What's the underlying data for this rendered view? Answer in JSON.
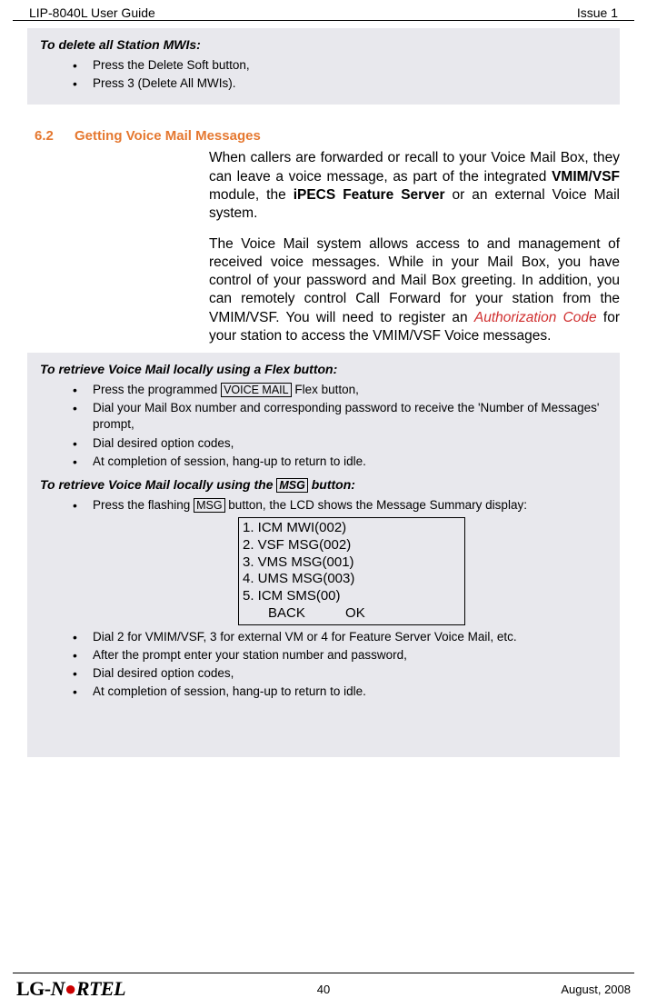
{
  "header": {
    "left": "LIP-8040L User Guide",
    "right": "Issue 1"
  },
  "box1": {
    "title": "To delete all Station MWIs:",
    "items": [
      "Press the Delete Soft button,",
      "Press 3 (Delete All MWIs)."
    ]
  },
  "section": {
    "num": "6.2",
    "title": "Getting Voice Mail Messages"
  },
  "para1_a": "When callers are forwarded or recall to your Voice Mail Box, they can leave a voice message, as part of the integrated ",
  "para1_b": "VMIM/VSF",
  "para1_c": " module, the ",
  "para1_d": "iPECS Feature Server",
  "para1_e": " or an external Voice Mail system.",
  "para2_a": "The Voice Mail system allows access to and management of received voice messages.  While in your Mail Box, you have control of your password and Mail Box greeting.  In addition, you can remotely control Call Forward for your station from the VMIM/VSF.  You will need to register an ",
  "para2_b": "Authorization Code",
  "para2_c": " for your station to access the VMIM/VSF Voice messages.",
  "box2": {
    "title1": "To retrieve Voice Mail locally using a Flex button:",
    "items1_pre": "Press the programmed ",
    "items1_key": "VOICE MAIL",
    "items1_post": " Flex button,",
    "items1b": "Dial your Mail Box number and corresponding password to receive the 'Number of Messages' prompt,",
    "items1c": "Dial desired option codes,",
    "items1d": "At completion of session, hang-up to return to idle.",
    "title2_pre": "To retrieve Voice Mail locally using the ",
    "title2_key": "MSG",
    "title2_post": " button:",
    "items2a_pre": "Press the flashing ",
    "items2a_key": "MSG",
    "items2a_post": " button, the LCD shows the Message Summary display:",
    "lcd": {
      "l1": "1. ICM MWI(002)",
      "l2": "2. VSF MSG(002)",
      "l3": "3. VMS MSG(001)",
      "l4": "4. UMS MSG(003)",
      "l5": "5. ICM SMS(00)",
      "btn1": "BACK",
      "btn2": "OK"
    },
    "items2b": "Dial 2 for VMIM/VSF, 3 for external VM or 4 for Feature Server Voice Mail, etc.",
    "items2c": "After the prompt enter your station number and password,",
    "items2d": "Dial desired option codes,",
    "items2e": "At completion of session, hang-up to return to idle."
  },
  "footer": {
    "logo_lg": "LG",
    "logo_dash": "-",
    "logo_n": "N",
    "logo_ortel": "RTEL",
    "page": "40",
    "date": "August, 2008"
  }
}
